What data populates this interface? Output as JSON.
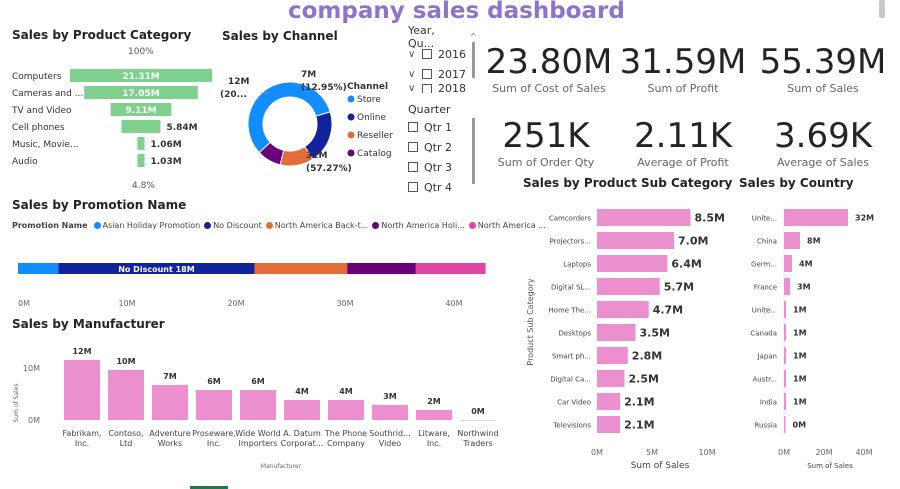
{
  "title": "company sales dashboard",
  "colors": {
    "green": "#7fcf8e",
    "pink": "#ec8fcf",
    "blue": "#118dff",
    "navy": "#12239e",
    "orange": "#e66c37",
    "purple": "#6b007b",
    "magenta": "#e044a7"
  },
  "product_category": {
    "title": "Sales by Product Category",
    "top_label": "100%",
    "bottom_label": "4.8%",
    "items": [
      {
        "name": "Computers",
        "value_label": "21.31M",
        "value": 21.31
      },
      {
        "name": "Cameras and ...",
        "value_label": "17.05M",
        "value": 17.05
      },
      {
        "name": "TV and Video",
        "value_label": "9.11M",
        "value": 9.11
      },
      {
        "name": "Cell phones",
        "value_label": "5.84M",
        "value": 5.84
      },
      {
        "name": "Music, Movie...",
        "value_label": "1.06M",
        "value": 1.06
      },
      {
        "name": "Audio",
        "value_label": "1.03M",
        "value": 1.03
      }
    ]
  },
  "channel": {
    "title": "Sales by Channel",
    "legend_title": "Channel",
    "legend": [
      "Store",
      "Online",
      "Reseller",
      "Catalog"
    ],
    "label_left_value": "12M",
    "label_left_pct": "(20...",
    "label_topright_value": "7M",
    "label_topright_pct": "(12.95%)",
    "label_bottom_value": "32M",
    "label_bottom_pct": "(57.27%)",
    "slices": [
      {
        "name": "Store",
        "pct": 57.27
      },
      {
        "name": "Online",
        "pct": 20.5
      },
      {
        "name": "Reseller",
        "pct": 12.95
      },
      {
        "name": "Catalog",
        "pct": 9.28
      }
    ]
  },
  "slicer_year": {
    "header": "Year, Qu...",
    "items": [
      "2016",
      "2017",
      "2018"
    ]
  },
  "slicer_quarter": {
    "header": "Quarter",
    "items": [
      "Qtr 1",
      "Qtr 2",
      "Qtr 3",
      "Qtr 4"
    ]
  },
  "kpis": [
    {
      "value": "23.80M",
      "label": "Sum of Cost of Sales"
    },
    {
      "value": "31.59M",
      "label": "Sum of Profit"
    },
    {
      "value": "55.39M",
      "label": "Sum of Sales"
    },
    {
      "value": "251K",
      "label": "Sum of Order Qty"
    },
    {
      "value": "2.11K",
      "label": "Average of Profit"
    },
    {
      "value": "3.69K",
      "label": "Average of Sales"
    }
  ],
  "promotion": {
    "title": "Sales by Promotion Name",
    "legend_title": "Promotion Name",
    "legend": [
      "Asian Holiday Promotion",
      "No Discount",
      "North America Back-t...",
      "North America Holi...",
      "North America ..."
    ],
    "bar_label": "No Discount 18M",
    "ticks": [
      "0M",
      "10M",
      "20M",
      "30M",
      "40M"
    ]
  },
  "manufacturer": {
    "title": "Sales by Manufacturer",
    "ylabel": "Sum of Sales",
    "xlabel": "Manufacturer",
    "yticks": [
      "10M",
      "0M"
    ]
  },
  "subcategory": {
    "title": "Sales by Product Sub Category",
    "ylabel": "Product Sub Category",
    "xlabel": "Sum of Sales",
    "ticks": [
      "0M",
      "5M",
      "10M"
    ]
  },
  "country": {
    "title": "Sales by Country",
    "xlabel": "Sum of Sales",
    "ticks": [
      "0M",
      "20M",
      "40M"
    ]
  },
  "chart_data": [
    {
      "type": "bar",
      "title": "Sales by Product Category",
      "categories": [
        "Computers",
        "Cameras and ...",
        "TV and Video",
        "Cell phones",
        "Music, Movie...",
        "Audio"
      ],
      "values": [
        21.31,
        17.05,
        9.11,
        5.84,
        1.06,
        1.03
      ]
    },
    {
      "type": "pie",
      "title": "Sales by Channel",
      "categories": [
        "Store",
        "Online",
        "Reseller",
        "Catalog"
      ],
      "values": [
        57.27,
        20.5,
        12.95,
        9.28
      ]
    },
    {
      "type": "bar",
      "title": "Sales by Promotion Name",
      "categories": [
        "Asian Holiday Promotion",
        "No Discount",
        "North America Back-t...",
        "North America Holi...",
        "North America ..."
      ],
      "values": [
        3.7,
        18,
        8.5,
        6.3,
        6.4
      ],
      "xlim": [
        0,
        40
      ]
    },
    {
      "type": "bar",
      "title": "Sales by Manufacturer",
      "categories": [
        "Fabrikam, Inc.",
        "Contoso, Ltd",
        "Adventure Works",
        "Proseware, Inc.",
        "Wide World Importers",
        "A. Datum Corporat...",
        "The Phone Company",
        "Southrid... Video",
        "Litware, Inc.",
        "Northwind Traders"
      ],
      "values": [
        12,
        10,
        7,
        6,
        6,
        4,
        4,
        3,
        2,
        0
      ],
      "value_labels": [
        "12M",
        "10M",
        "7M",
        "6M",
        "6M",
        "4M",
        "4M",
        "3M",
        "2M",
        "0M"
      ],
      "xlabel": "Manufacturer",
      "ylabel": "Sum of Sales"
    },
    {
      "type": "bar",
      "title": "Sales by Product Sub Category",
      "categories": [
        "Camcorders",
        "Projectors...",
        "Laptops",
        "Digital SL...",
        "Home The...",
        "Desktops",
        "Smart ph...",
        "Digital Ca...",
        "Car Video",
        "Televisions"
      ],
      "values": [
        8.5,
        7.0,
        6.4,
        5.7,
        4.7,
        3.5,
        2.8,
        2.5,
        2.1,
        2.1
      ],
      "value_labels": [
        "8.5M",
        "7.0M",
        "6.4M",
        "5.7M",
        "4.7M",
        "3.5M",
        "2.8M",
        "2.5M",
        "2.1M",
        "2.1M"
      ],
      "xlabel": "Sum of Sales",
      "ylabel": "Product Sub Category",
      "xlim": [
        0,
        10
      ]
    },
    {
      "type": "bar",
      "title": "Sales by Country",
      "categories": [
        "Unite...",
        "China",
        "Germ...",
        "France",
        "Unite...",
        "Canada",
        "Japan",
        "Austr...",
        "India",
        "Russia"
      ],
      "values": [
        32,
        8,
        4,
        3,
        1,
        1,
        1,
        1,
        1,
        0
      ],
      "value_labels": [
        "32M",
        "8M",
        "4M",
        "3M",
        "1M",
        "1M",
        "1M",
        "1M",
        "1M",
        "0M"
      ],
      "xlabel": "Sum of Sales",
      "xlim": [
        0,
        40
      ]
    }
  ]
}
